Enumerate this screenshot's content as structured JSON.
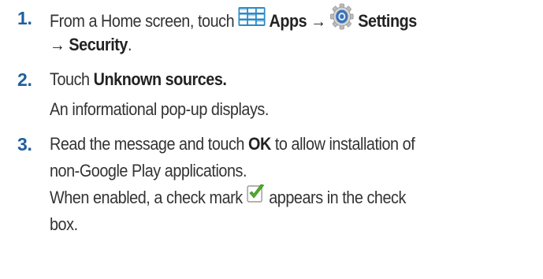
{
  "steps": [
    {
      "number": "1.",
      "line1": {
        "t1": "From a Home screen, touch ",
        "apps_icon": "apps-grid-icon",
        "apps": "Apps",
        "arrow1": " → ",
        "settings_icon": "settings-gear-icon",
        "settings": "Settings"
      },
      "line2": {
        "arrow2": "→ ",
        "security": "Security",
        "end": "."
      }
    },
    {
      "number": "2.",
      "t1": "Touch ",
      "unknown_sources": "Unknown sources.",
      "result": "An informational pop-up displays."
    },
    {
      "number": "3.",
      "t1": "Read the message and touch ",
      "ok": "OK",
      "t2": " to allow installation of",
      "t3": "non-Google Play applications.",
      "r1": "When enabled, a check mark ",
      "check_icon": "check-mark-icon",
      "r2": " appears in the check",
      "r3": "box."
    }
  ],
  "colors": {
    "step_number": "#1f5f9f",
    "text": "#333333",
    "apps_icon": "#2a8ac8",
    "settings_icon": "#3b73b8",
    "check_green": "#4caf2a"
  }
}
